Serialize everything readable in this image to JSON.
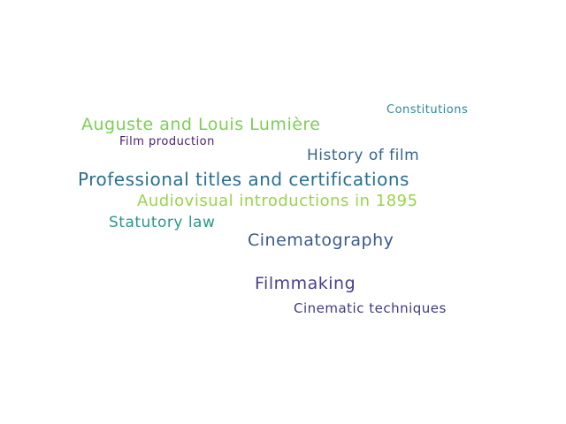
{
  "words": [
    {
      "text": "Professional titles and certifications",
      "color": "#2a6f8f"
    },
    {
      "text": "Audiovisual introductions in 1895",
      "color": "#9bd34a"
    },
    {
      "text": "Auguste and Louis Lumière",
      "color": "#7ccf55"
    },
    {
      "text": "Cinematography",
      "color": "#3a5a8c"
    },
    {
      "text": "History of film",
      "color": "#33658f"
    },
    {
      "text": "Filmmaking",
      "color": "#4a3f8c"
    },
    {
      "text": "Statutory law",
      "color": "#27998a"
    },
    {
      "text": "Cinematic techniques",
      "color": "#3f3a86"
    },
    {
      "text": "Constitutions",
      "color": "#2a8a9a"
    },
    {
      "text": "Film production",
      "color": "#4b1c6e"
    }
  ]
}
